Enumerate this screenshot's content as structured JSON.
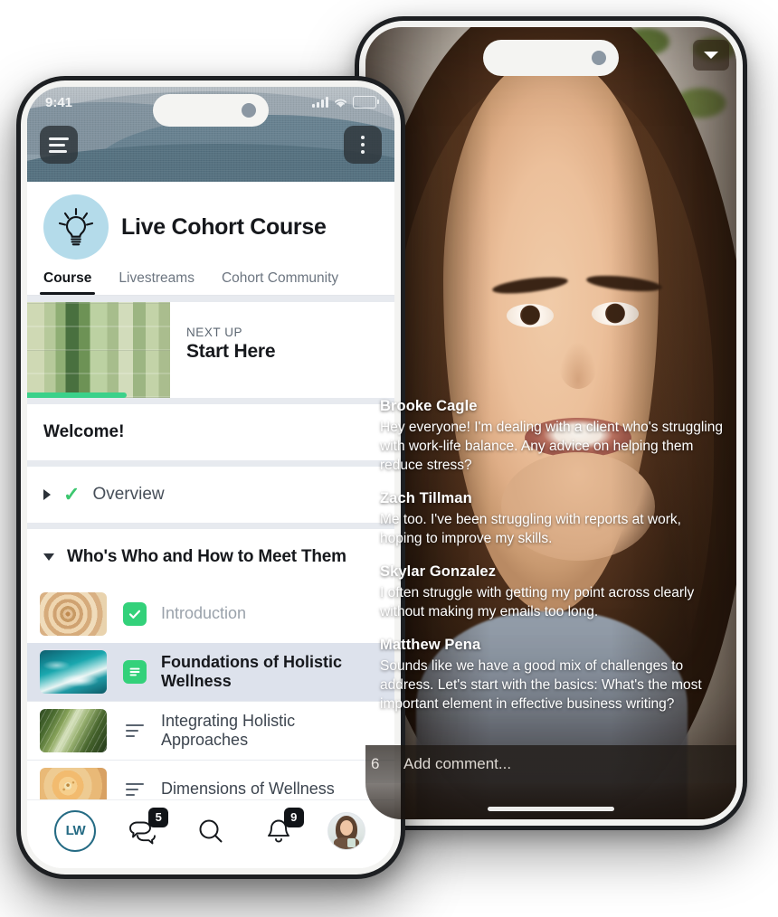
{
  "left_phone": {
    "status_bar": {
      "time": "9:41",
      "signal_icon": "cellular-bars-icon",
      "wifi_icon": "wifi-icon",
      "battery_icon": "battery-icon"
    },
    "hero": {
      "menu_icon": "hamburger-menu-icon",
      "more_icon": "kebab-menu-icon"
    },
    "brand": {
      "logo_icon": "lightbulb-icon",
      "title": "Live Cohort Course"
    },
    "tabs": [
      {
        "label": "Course",
        "active": true
      },
      {
        "label": "Livestreams",
        "active": false
      },
      {
        "label": "Cohort Community",
        "active": false
      }
    ],
    "next_up": {
      "kicker": "NEXT UP",
      "title": "Start Here",
      "thumb_icon": "bamboo-thumbnail",
      "progress_percent": 27,
      "progress_color": "#3bd18a"
    },
    "sections": [
      {
        "type": "header",
        "label": "Welcome!"
      },
      {
        "type": "module",
        "label": "Overview",
        "expanded": false,
        "completed": true,
        "caret_icon": "triangle-right-icon",
        "check_icon": "check-icon"
      },
      {
        "type": "module",
        "label": "Who's Who and How to Meet Them",
        "expanded": true,
        "completed": false,
        "caret_icon": "triangle-down-icon"
      }
    ],
    "lessons": [
      {
        "title": "Introduction",
        "state": "completed",
        "icon": "check-square-icon",
        "thumb": "wood-rings-thumbnail",
        "selected": false
      },
      {
        "title": "Foundations of Holistic Wellness",
        "state": "current",
        "icon": "text-lesson-icon",
        "thumb": "ocean-waves-thumbnail",
        "selected": true
      },
      {
        "title": "Integrating Holistic Approaches",
        "state": "default",
        "icon": "text-lines-icon",
        "thumb": "palm-leaf-thumbnail",
        "selected": false
      },
      {
        "title": "Dimensions of Wellness",
        "state": "default",
        "icon": "text-lines-icon",
        "thumb": "flower-thumbnail",
        "selected": false
      }
    ],
    "bottom_nav": [
      {
        "name": "home",
        "icon": "lw-logo-icon",
        "label": "LW",
        "badge": null
      },
      {
        "name": "messages",
        "icon": "chat-bubbles-icon",
        "badge": "5"
      },
      {
        "name": "search",
        "icon": "search-icon",
        "badge": null
      },
      {
        "name": "notifications",
        "icon": "bell-icon",
        "badge": "9"
      },
      {
        "name": "profile",
        "icon": "avatar-icon",
        "badge": null
      }
    ]
  },
  "right_phone": {
    "collapse_icon": "chevron-down-icon",
    "comments": [
      {
        "author": "Brooke Cagle",
        "text": "Hey everyone! I'm dealing with a client who's struggling with work-life balance. Any advice on helping them reduce stress?"
      },
      {
        "author": "Zach Tillman",
        "text": "Me too. I've been struggling with reports at work, hoping to improve my skills."
      },
      {
        "author": "Skylar Gonzalez",
        "text": "I often struggle with getting my point across clearly without making my emails too long."
      },
      {
        "author": "Matthew Pena",
        "text": "Sounds like we have a good mix of challenges to address. Let's start with the basics: What's the most important element in effective business writing?"
      }
    ],
    "composer": {
      "like_count": "6",
      "placeholder": "Add comment..."
    }
  }
}
